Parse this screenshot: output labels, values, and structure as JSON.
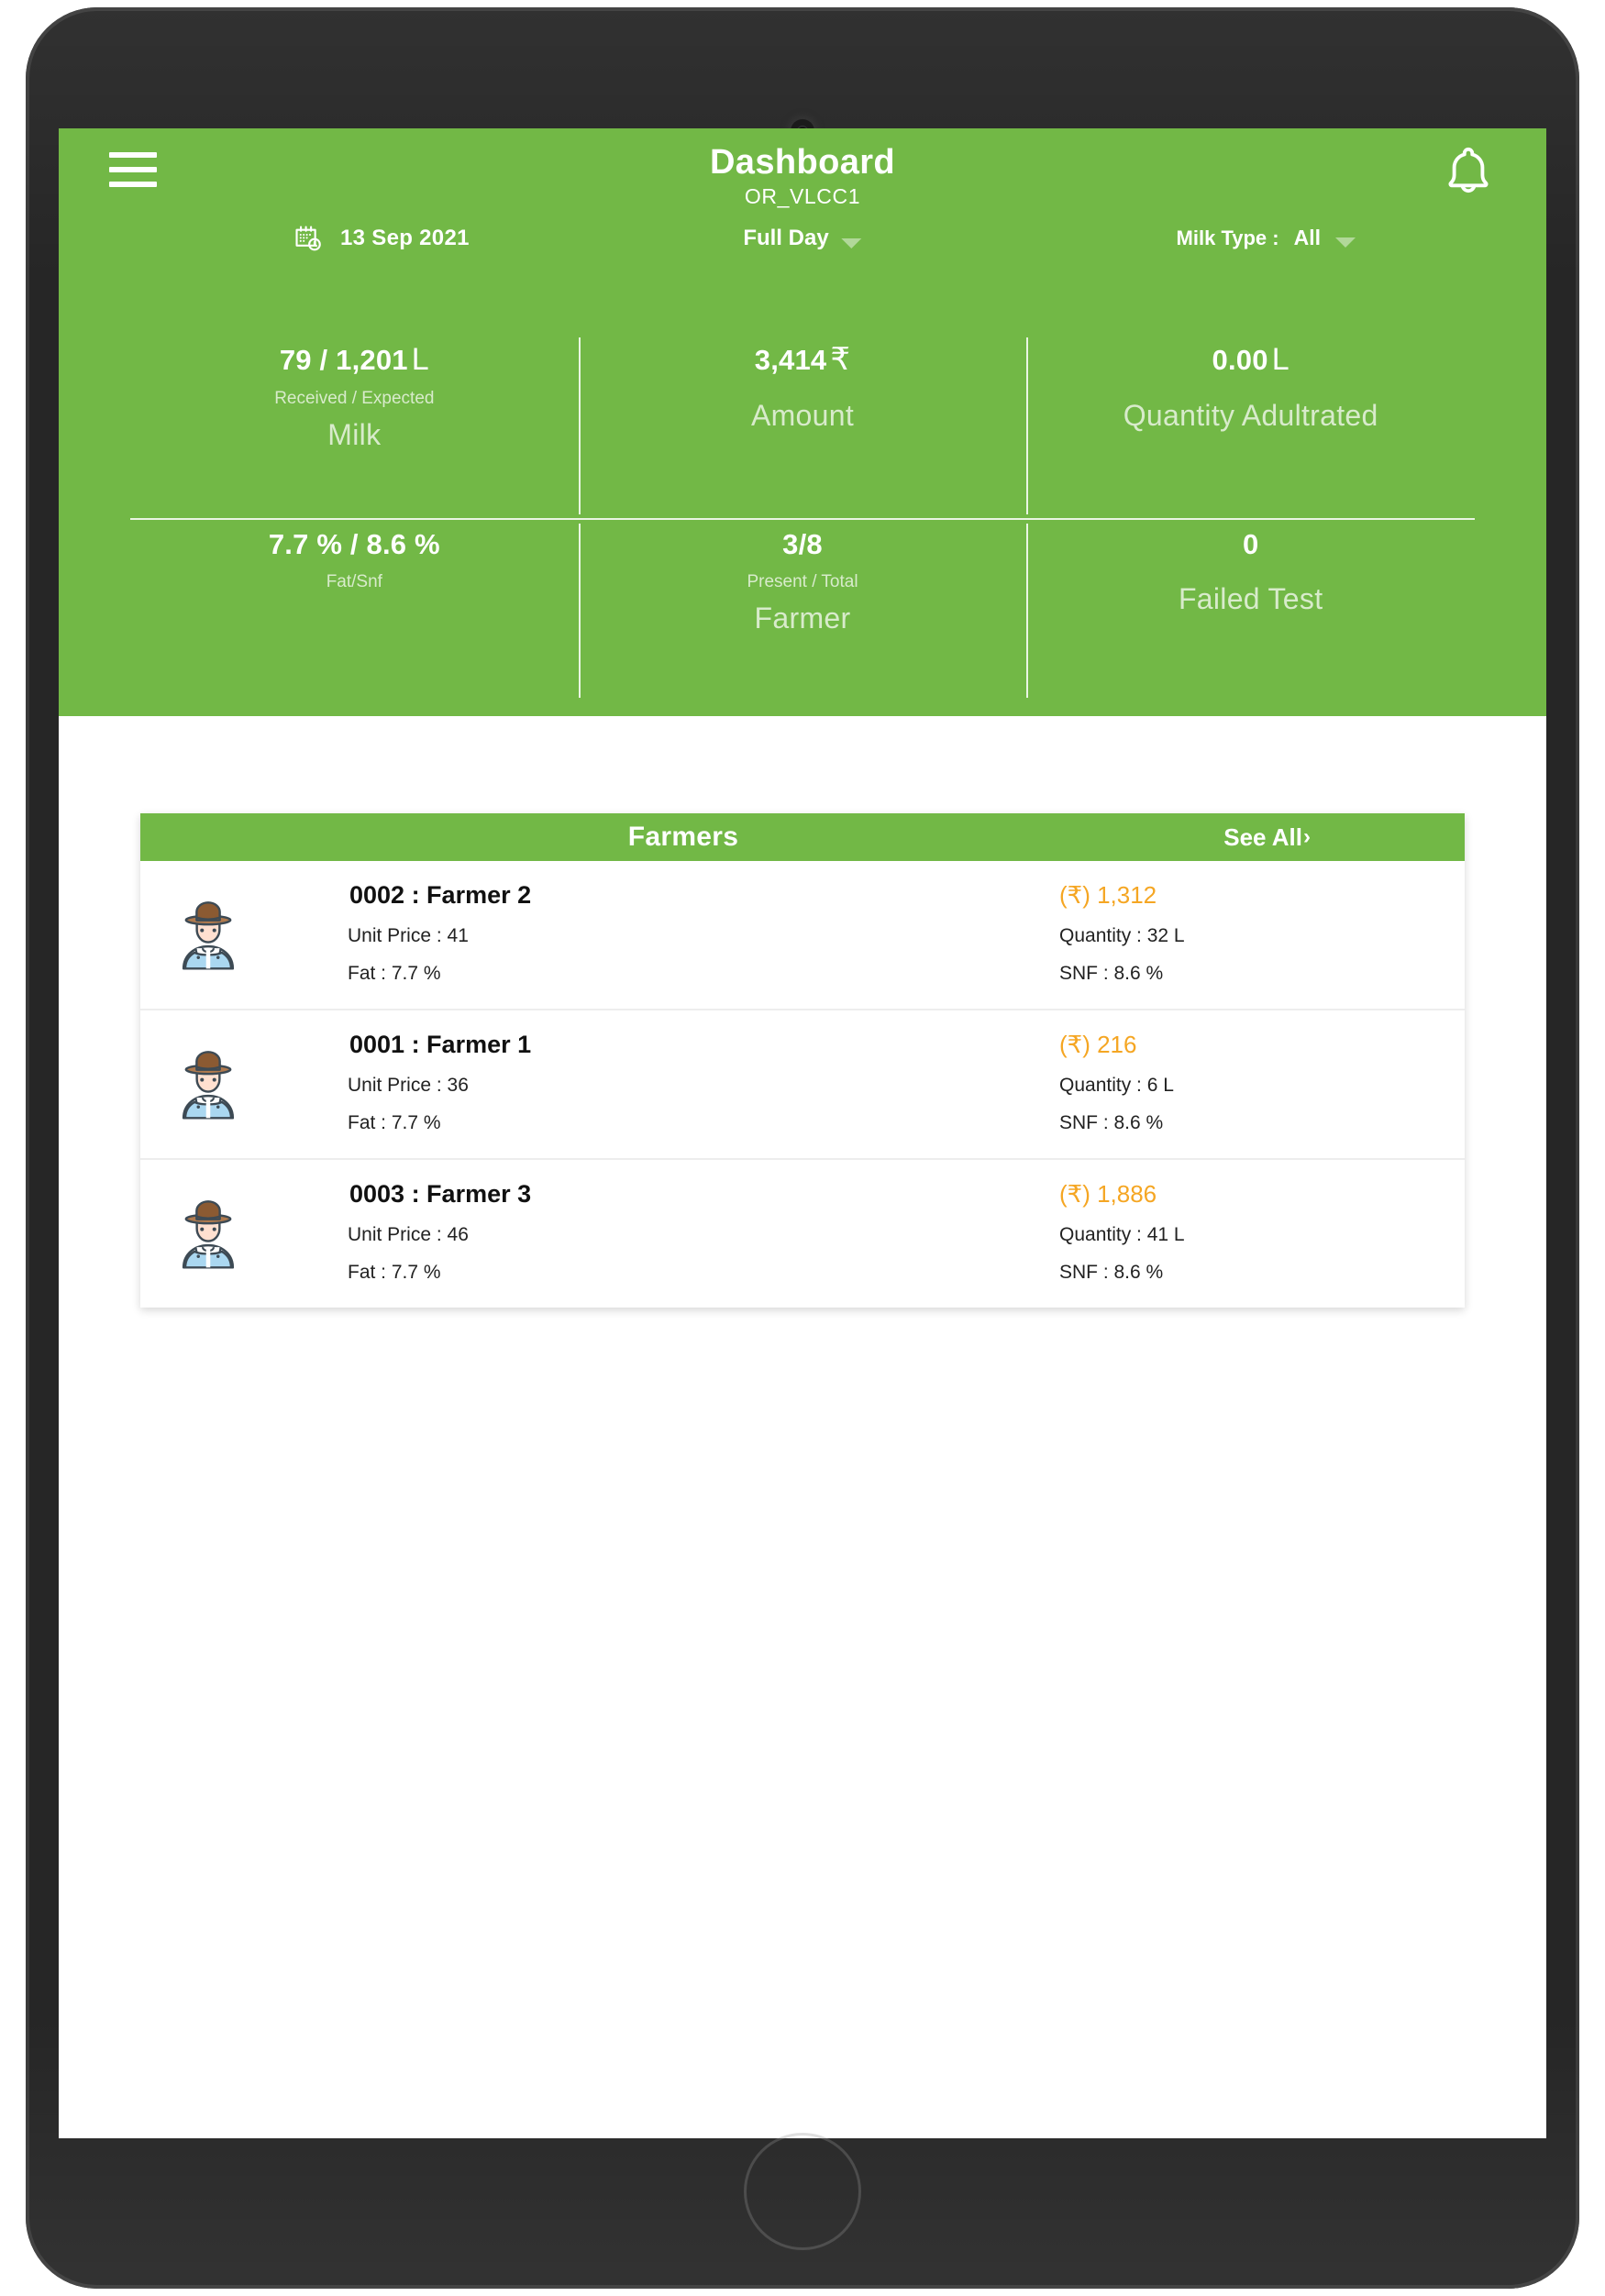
{
  "header": {
    "title": "Dashboard",
    "subtitle": "OR_VLCC1",
    "menu_icon": "hamburger-icon",
    "bell_icon": "notification-bell-icon",
    "accent_green": "#72b846"
  },
  "filters": {
    "calendar_icon": "calendar-clock-icon",
    "date": "13 Sep 2021",
    "shift": "Full Day",
    "milk_type_label": "Milk Type :",
    "milk_type_value": "All"
  },
  "stats": {
    "row1": [
      {
        "value": "79 / 1,201",
        "unit": "L",
        "sub": "Received / Expected",
        "name": "Milk"
      },
      {
        "value": "3,414",
        "unit": "₹",
        "sub": "",
        "name": "Amount"
      },
      {
        "value": "0.00",
        "unit": "L",
        "sub": "",
        "name": "Quantity Adultrated"
      }
    ],
    "row2": [
      {
        "value": "7.7 % / 8.6 %",
        "unit": "",
        "sub": "Fat/Snf",
        "name": ""
      },
      {
        "value": "3/8",
        "unit": "",
        "sub": "Present / Total",
        "name": "Farmer"
      },
      {
        "value": "0",
        "unit": "",
        "sub": "",
        "name": "Failed Test"
      }
    ]
  },
  "farmers_card": {
    "title": "Farmers",
    "see_all": "See All",
    "see_all_chevron": "›",
    "amount_color": "#f5a623",
    "rows": [
      {
        "avatar_icon": "farmer-avatar-icon",
        "name": "0002 : Farmer 2",
        "amount": "(₹) 1,312",
        "unit_price": "Unit Price : 41",
        "quantity": "Quantity : 32 L",
        "fat": "Fat : 7.7 %",
        "snf": "SNF : 8.6 %"
      },
      {
        "avatar_icon": "farmer-avatar-icon",
        "name": "0001 : Farmer 1",
        "amount": "(₹) 216",
        "unit_price": "Unit Price : 36",
        "quantity": "Quantity : 6 L",
        "fat": "Fat : 7.7 %",
        "snf": "SNF : 8.6 %"
      },
      {
        "avatar_icon": "farmer-avatar-icon",
        "name": "0003 : Farmer 3",
        "amount": "(₹) 1,886",
        "unit_price": "Unit Price : 46",
        "quantity": "Quantity : 41 L",
        "fat": "Fat : 7.7 %",
        "snf": "SNF : 8.6 %"
      }
    ]
  },
  "device": {
    "camera_icon": "front-camera-icon",
    "home_button_icon": "home-button-icon"
  }
}
